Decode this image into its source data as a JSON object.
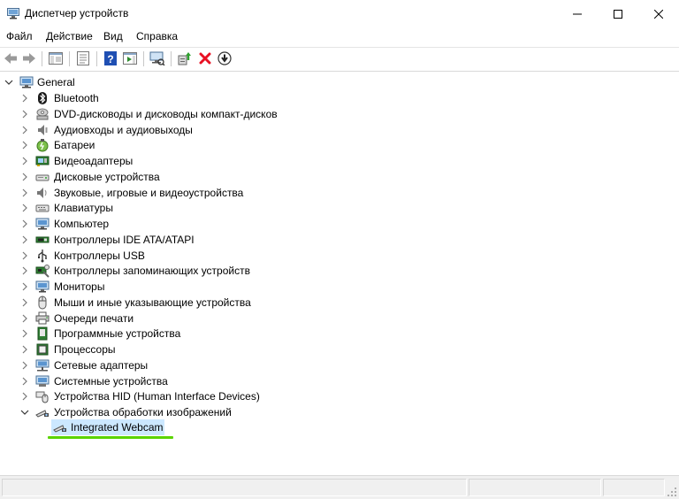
{
  "window": {
    "title": "Диспетчер устройств",
    "title_icon": "device-manager-icon",
    "controls": [
      "minimize-icon",
      "maximize-icon",
      "close-icon"
    ]
  },
  "menu": {
    "file": "Файл",
    "action": "Действие",
    "view": "Вид",
    "help": "Справка"
  },
  "toolbar": {
    "buttons": [
      "back-arrow-icon",
      "forward-arrow-icon",
      "show-hide-tree-icon",
      "properties-icon",
      "help-icon",
      "show-hide-action-pane-icon",
      "scan-hardware-icon",
      "update-driver-icon",
      "uninstall-icon",
      "disable-device-icon"
    ],
    "colors": {
      "uninstall": "#e81123",
      "help": "#1f4fb3"
    }
  },
  "tree": {
    "root": {
      "label": "General",
      "expanded": true
    },
    "categories": [
      {
        "label": "Bluetooth",
        "icon": "bluetooth-icon"
      },
      {
        "label": "DVD-дисководы и дисководы компакт-дисков",
        "icon": "dvd-drive-icon"
      },
      {
        "label": "Аудиовходы и аудиовыходы",
        "icon": "audio-io-icon"
      },
      {
        "label": "Батареи",
        "icon": "battery-icon"
      },
      {
        "label": "Видеоадаптеры",
        "icon": "display-adapter-icon"
      },
      {
        "label": "Дисковые устройства",
        "icon": "disk-drive-icon"
      },
      {
        "label": "Звуковые, игровые и видеоустройства",
        "icon": "sound-icon"
      },
      {
        "label": "Клавиатуры",
        "icon": "keyboard-icon"
      },
      {
        "label": "Компьютер",
        "icon": "computer-icon"
      },
      {
        "label": "Контроллеры IDE ATA/ATAPI",
        "icon": "ide-controller-icon"
      },
      {
        "label": "Контроллеры USB",
        "icon": "usb-icon"
      },
      {
        "label": "Контроллеры запоминающих устройств",
        "icon": "storage-controller-icon"
      },
      {
        "label": "Мониторы",
        "icon": "monitor-icon"
      },
      {
        "label": "Мыши и иные указывающие устройства",
        "icon": "mouse-icon"
      },
      {
        "label": "Очереди печати",
        "icon": "printer-icon"
      },
      {
        "label": "Программные устройства",
        "icon": "software-device-icon"
      },
      {
        "label": "Процессоры",
        "icon": "processor-icon"
      },
      {
        "label": "Сетевые адаптеры",
        "icon": "network-adapter-icon"
      },
      {
        "label": "Системные устройства",
        "icon": "system-device-icon"
      },
      {
        "label": "Устройства HID (Human Interface Devices)",
        "icon": "hid-icon"
      },
      {
        "label": "Устройства обработки изображений",
        "icon": "imaging-device-icon",
        "expanded": true
      }
    ],
    "devices": [
      {
        "label": "Integrated Webcam",
        "icon": "webcam-icon",
        "selected": true
      }
    ],
    "highlight_color": "#5bd400",
    "selection_color": "#cce8ff"
  }
}
